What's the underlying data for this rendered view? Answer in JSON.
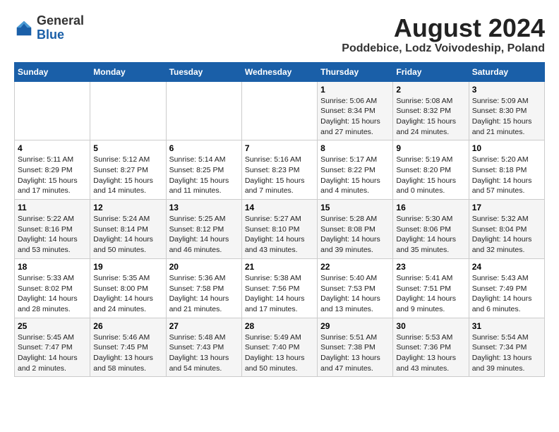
{
  "logo": {
    "general": "General",
    "blue": "Blue"
  },
  "title": {
    "month_year": "August 2024",
    "location": "Poddebice, Lodz Voivodeship, Poland"
  },
  "weekdays": [
    "Sunday",
    "Monday",
    "Tuesday",
    "Wednesday",
    "Thursday",
    "Friday",
    "Saturday"
  ],
  "weeks": [
    [
      {
        "day": "",
        "content": ""
      },
      {
        "day": "",
        "content": ""
      },
      {
        "day": "",
        "content": ""
      },
      {
        "day": "",
        "content": ""
      },
      {
        "day": "1",
        "content": "Sunrise: 5:06 AM\nSunset: 8:34 PM\nDaylight: 15 hours\nand 27 minutes."
      },
      {
        "day": "2",
        "content": "Sunrise: 5:08 AM\nSunset: 8:32 PM\nDaylight: 15 hours\nand 24 minutes."
      },
      {
        "day": "3",
        "content": "Sunrise: 5:09 AM\nSunset: 8:30 PM\nDaylight: 15 hours\nand 21 minutes."
      }
    ],
    [
      {
        "day": "4",
        "content": "Sunrise: 5:11 AM\nSunset: 8:29 PM\nDaylight: 15 hours\nand 17 minutes."
      },
      {
        "day": "5",
        "content": "Sunrise: 5:12 AM\nSunset: 8:27 PM\nDaylight: 15 hours\nand 14 minutes."
      },
      {
        "day": "6",
        "content": "Sunrise: 5:14 AM\nSunset: 8:25 PM\nDaylight: 15 hours\nand 11 minutes."
      },
      {
        "day": "7",
        "content": "Sunrise: 5:16 AM\nSunset: 8:23 PM\nDaylight: 15 hours\nand 7 minutes."
      },
      {
        "day": "8",
        "content": "Sunrise: 5:17 AM\nSunset: 8:22 PM\nDaylight: 15 hours\nand 4 minutes."
      },
      {
        "day": "9",
        "content": "Sunrise: 5:19 AM\nSunset: 8:20 PM\nDaylight: 15 hours\nand 0 minutes."
      },
      {
        "day": "10",
        "content": "Sunrise: 5:20 AM\nSunset: 8:18 PM\nDaylight: 14 hours\nand 57 minutes."
      }
    ],
    [
      {
        "day": "11",
        "content": "Sunrise: 5:22 AM\nSunset: 8:16 PM\nDaylight: 14 hours\nand 53 minutes."
      },
      {
        "day": "12",
        "content": "Sunrise: 5:24 AM\nSunset: 8:14 PM\nDaylight: 14 hours\nand 50 minutes."
      },
      {
        "day": "13",
        "content": "Sunrise: 5:25 AM\nSunset: 8:12 PM\nDaylight: 14 hours\nand 46 minutes."
      },
      {
        "day": "14",
        "content": "Sunrise: 5:27 AM\nSunset: 8:10 PM\nDaylight: 14 hours\nand 43 minutes."
      },
      {
        "day": "15",
        "content": "Sunrise: 5:28 AM\nSunset: 8:08 PM\nDaylight: 14 hours\nand 39 minutes."
      },
      {
        "day": "16",
        "content": "Sunrise: 5:30 AM\nSunset: 8:06 PM\nDaylight: 14 hours\nand 35 minutes."
      },
      {
        "day": "17",
        "content": "Sunrise: 5:32 AM\nSunset: 8:04 PM\nDaylight: 14 hours\nand 32 minutes."
      }
    ],
    [
      {
        "day": "18",
        "content": "Sunrise: 5:33 AM\nSunset: 8:02 PM\nDaylight: 14 hours\nand 28 minutes."
      },
      {
        "day": "19",
        "content": "Sunrise: 5:35 AM\nSunset: 8:00 PM\nDaylight: 14 hours\nand 24 minutes."
      },
      {
        "day": "20",
        "content": "Sunrise: 5:36 AM\nSunset: 7:58 PM\nDaylight: 14 hours\nand 21 minutes."
      },
      {
        "day": "21",
        "content": "Sunrise: 5:38 AM\nSunset: 7:56 PM\nDaylight: 14 hours\nand 17 minutes."
      },
      {
        "day": "22",
        "content": "Sunrise: 5:40 AM\nSunset: 7:53 PM\nDaylight: 14 hours\nand 13 minutes."
      },
      {
        "day": "23",
        "content": "Sunrise: 5:41 AM\nSunset: 7:51 PM\nDaylight: 14 hours\nand 9 minutes."
      },
      {
        "day": "24",
        "content": "Sunrise: 5:43 AM\nSunset: 7:49 PM\nDaylight: 14 hours\nand 6 minutes."
      }
    ],
    [
      {
        "day": "25",
        "content": "Sunrise: 5:45 AM\nSunset: 7:47 PM\nDaylight: 14 hours\nand 2 minutes."
      },
      {
        "day": "26",
        "content": "Sunrise: 5:46 AM\nSunset: 7:45 PM\nDaylight: 13 hours\nand 58 minutes."
      },
      {
        "day": "27",
        "content": "Sunrise: 5:48 AM\nSunset: 7:43 PM\nDaylight: 13 hours\nand 54 minutes."
      },
      {
        "day": "28",
        "content": "Sunrise: 5:49 AM\nSunset: 7:40 PM\nDaylight: 13 hours\nand 50 minutes."
      },
      {
        "day": "29",
        "content": "Sunrise: 5:51 AM\nSunset: 7:38 PM\nDaylight: 13 hours\nand 47 minutes."
      },
      {
        "day": "30",
        "content": "Sunrise: 5:53 AM\nSunset: 7:36 PM\nDaylight: 13 hours\nand 43 minutes."
      },
      {
        "day": "31",
        "content": "Sunrise: 5:54 AM\nSunset: 7:34 PM\nDaylight: 13 hours\nand 39 minutes."
      }
    ]
  ]
}
